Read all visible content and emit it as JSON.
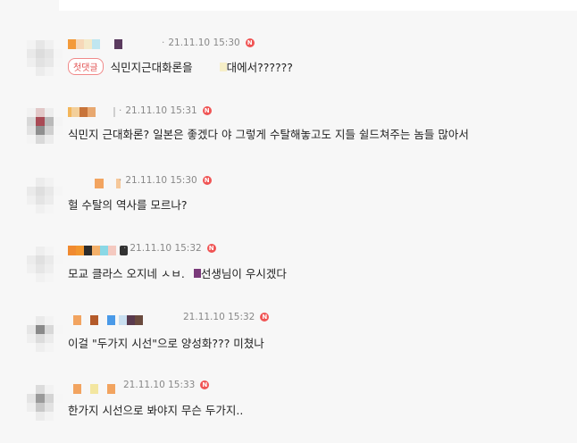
{
  "comments": [
    {
      "time": "21.11.10 15:30",
      "badge": "N",
      "tag": "첫댓글",
      "text_a": "식민지근대화론을",
      "text_b": "대에서??????"
    },
    {
      "time": "21.11.10 15:31",
      "badge": "N",
      "text": "식민지 근대화론? 일본은 좋겠다 야 그렇게 수탈해놓고도 지들 쉴드쳐주는 놈들 많아서"
    },
    {
      "time": "21.11.10 15:30",
      "badge": "N",
      "text": "헐 수탈의 역사를 모르나?"
    },
    {
      "time": "21.11.10 15:32",
      "badge": "N",
      "text_a": "모교 클라스 오지네 ㅅㅂ.",
      "text_b": "선생님이 우시겠다"
    },
    {
      "time": "21.11.10 15:32",
      "badge": "N",
      "text": "이걸 \"두가지 시선\"으로 양성화??? 미쳤나"
    },
    {
      "time": "21.11.10 15:33",
      "badge": "N",
      "text": "한가지 시선으로 봐야지 무슨 두가지.."
    }
  ],
  "colors": {
    "badge": "#f05454",
    "tag_border": "#f08a8a",
    "tag_text": "#e25555"
  }
}
